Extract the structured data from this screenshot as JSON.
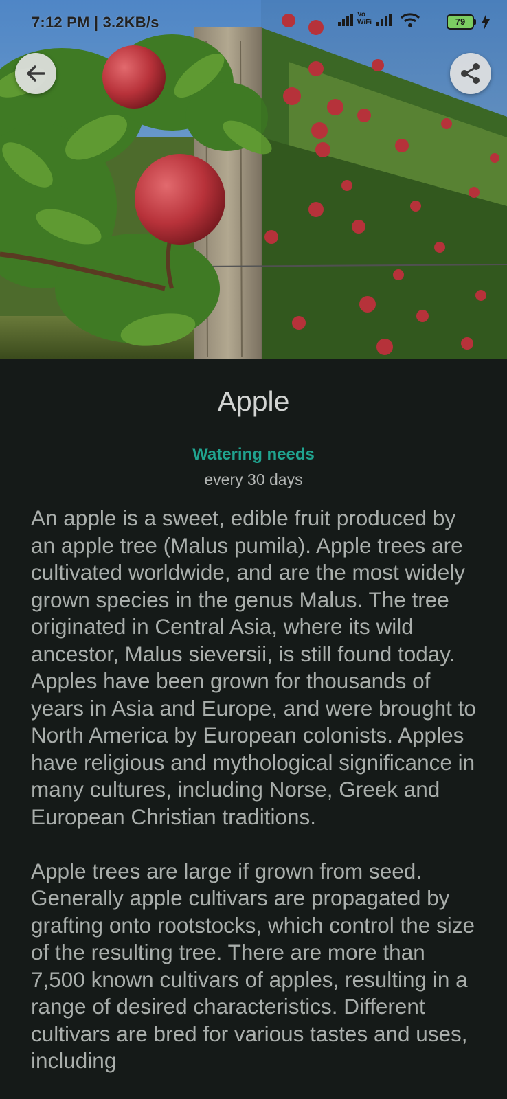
{
  "status_bar": {
    "time_speed": "7:12 PM | 3.2KB/s",
    "network_label": "Vo WiFi",
    "battery_level": "79"
  },
  "hero": {
    "image_subject": "apple orchard with red apples on tree branches",
    "back_icon": "arrow-left-icon",
    "share_icon": "share-icon"
  },
  "plant": {
    "name": "Apple",
    "watering_label": "Watering needs",
    "watering_value": "every 30 days",
    "description": "An apple is a sweet, edible fruit produced by an apple tree (Malus pumila). Apple trees are cultivated worldwide, and are the most widely grown species in the genus Malus. The tree originated in Central Asia, where its wild ancestor, Malus sieversii, is still found today. Apples have been grown for thousands of years in Asia and Europe, and were brought to North America by European colonists. Apples have religious and mythological significance in many cultures, including Norse, Greek and European Christian traditions.\n\nApple trees are large if grown from seed. Generally apple cultivars are propagated by grafting onto rootstocks, which control the size of the resulting tree. There are more than 7,500 known cultivars of apples, resulting in a range of desired characteristics. Different cultivars are bred for various tastes and uses, including"
  },
  "colors": {
    "background": "#151a18",
    "accent": "#20a38f",
    "title": "#d2d4d2",
    "body_text": "#a9aeab"
  }
}
